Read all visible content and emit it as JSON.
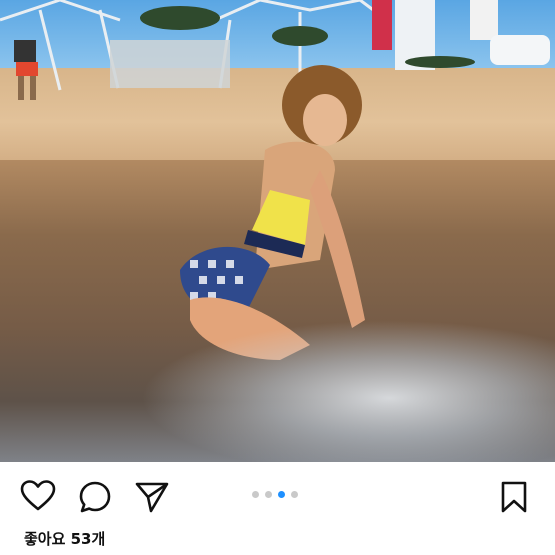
{
  "post": {
    "image_description_icon": "beach-photo",
    "carousel": {
      "count": 4,
      "active_index": 2
    },
    "likes_label": "좋아요 53개"
  },
  "colors": {
    "accent_dot": "#1e90ff",
    "inactive_dot": "#c9c9c9"
  },
  "actions": {
    "like_icon": "heart-icon",
    "comment_icon": "comment-bubble-icon",
    "share_icon": "paper-plane-icon",
    "save_icon": "bookmark-icon"
  }
}
